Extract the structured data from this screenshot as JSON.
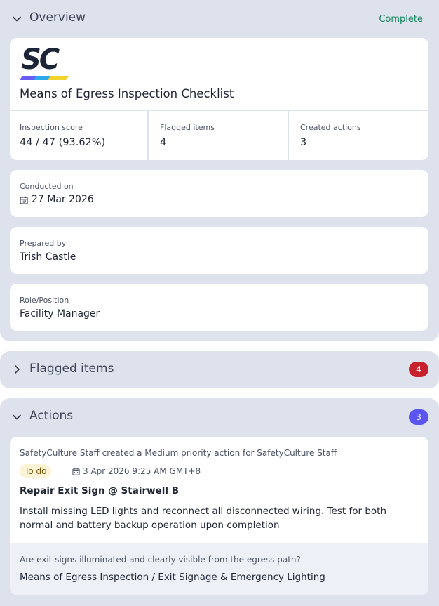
{
  "overview": {
    "title": "Overview",
    "status": "Complete",
    "status_color": "#13855b",
    "logo_text": "SC",
    "checklist_title": "Means of Egress Inspection Checklist",
    "stats": [
      {
        "label": "Inspection score",
        "value": "44 / 47 (93.62%)"
      },
      {
        "label": "Flagged items",
        "value": "4"
      },
      {
        "label": "Created actions",
        "value": "3"
      }
    ],
    "conducted_on": {
      "label": "Conducted on",
      "value": "27 Mar 2026",
      "icon": "calendar-icon"
    },
    "prepared_by": {
      "label": "Prepared by",
      "value": "Trish Castle"
    },
    "role": {
      "label": "Role/Position",
      "value": "Facility Manager"
    }
  },
  "flagged": {
    "title": "Flagged items",
    "count": "4",
    "badge_color": "#c8212e"
  },
  "actions": {
    "title": "Actions",
    "count": "3",
    "badge_color": "#5a55f0",
    "item": {
      "meta": "SafetyCulture Staff created a Medium priority action for SafetyCulture Staff",
      "status": "To do",
      "due": "3 Apr 2026 9:25 AM GMT+8",
      "title": "Repair Exit Sign @ Stairwell B",
      "description": "Install missing LED lights and reconnect all disconnected wiring. Test for both normal and battery backup operation upon completion",
      "question": "Are exit signs illuminated and clearly visible from the egress path?",
      "path": "Means of Egress Inspection / Exit Signage & Emergency Lighting"
    }
  }
}
